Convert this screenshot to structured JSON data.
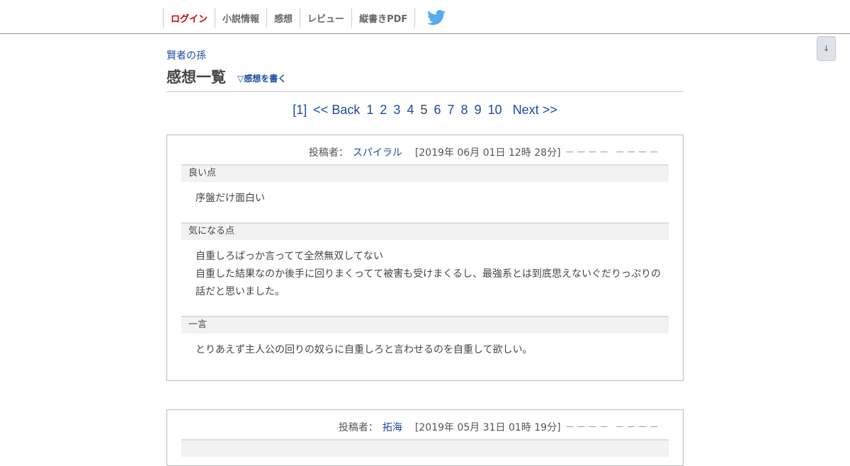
{
  "nav": {
    "items": [
      "ログイン",
      "小説情報",
      "感想",
      "レビュー",
      "縦書きPDF"
    ],
    "twitter_icon": "twitter-bird-icon",
    "twitter_color": "#55acee",
    "login_color": "#cc0000"
  },
  "float_button": "↓",
  "breadcrumb": "賢者の孫",
  "page_title": "感想一覧",
  "write_link": "▽感想を書く",
  "pager": {
    "first": "[1]",
    "back": "<< Back",
    "pages": [
      "1",
      "2",
      "3",
      "4",
      "5",
      "6",
      "7",
      "8",
      "9",
      "10"
    ],
    "current": "5",
    "next": "Next >>"
  },
  "reviews": [
    {
      "poster_label": "投稿者：",
      "poster": "スパイラル",
      "date": "[2019年 06月 01日 12時 28分]",
      "dashes": "－－－－ －－－－",
      "good_label": "良い点",
      "good": "序盤だけ面白い",
      "concern_label": "気になる点",
      "concern_line1": "自重しろばっか言ってて全然無双してない",
      "concern_line2": "自重した結果なのか後手に回りまくってて被害も受けまくるし、最強系とは到底思えないぐだりっぷりの",
      "concern_line3": "話だと思いました。",
      "comment_label": "一言",
      "comment": "とりあえず主人公の回りの奴らに自重しろと言わせるのを自重して欲しい。"
    },
    {
      "poster_label": "投稿者：",
      "poster": "拓海",
      "date": "[2019年 05月 31日 01時 19分]",
      "dashes": "－－－－ －－－－"
    }
  ]
}
